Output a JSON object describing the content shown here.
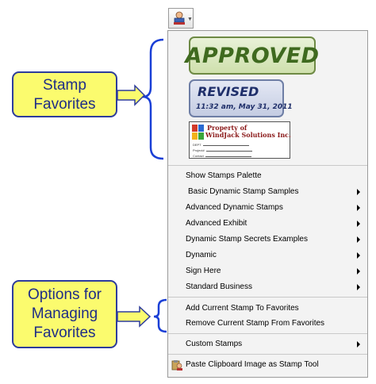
{
  "menu": {
    "items": [
      {
        "label": "Show Stamps Palette",
        "submenu": false
      },
      {
        "label": "Basic Dynamic Stamp Samples",
        "submenu": true
      },
      {
        "label": "Advanced Dynamic Stamps",
        "submenu": true
      },
      {
        "label": "Advanced Exhibit",
        "submenu": true
      },
      {
        "label": "Dynamic Stamp Secrets Examples",
        "submenu": true
      },
      {
        "label": "Dynamic",
        "submenu": true
      },
      {
        "label": "Sign Here",
        "submenu": true
      },
      {
        "label": "Standard Business",
        "submenu": true
      },
      {
        "label": "Add Current Stamp To Favorites",
        "submenu": false
      },
      {
        "label": "Remove Current Stamp From Favorites",
        "submenu": false
      },
      {
        "label": "Custom Stamps",
        "submenu": true
      },
      {
        "label": "Paste Clipboard Image as Stamp Tool",
        "submenu": false
      }
    ]
  },
  "favorites": {
    "approved": {
      "text": "APPROVED"
    },
    "revised": {
      "title": "REVISED",
      "date": "11:32 am, May 31, 2011"
    },
    "property": {
      "line1": "Property of",
      "line2": "WindJack Solutions Inc.",
      "fields": [
        "DEPT",
        "Project#",
        "Contact"
      ]
    }
  },
  "callouts": {
    "favorites": {
      "line1": "Stamp",
      "line2": "Favorites"
    },
    "managing": {
      "line1": "Options for",
      "line2": "Managing",
      "line3": "Favorites"
    }
  },
  "icons": {
    "toolbar": "stamp-tool-icon",
    "paste": "paste-clipboard-icon"
  },
  "colors": {
    "callout_fill": "#fbfb6e",
    "callout_border": "#2e3c9c",
    "bracket": "#1a3fd6",
    "approved": "#3f6a1f",
    "revised": "#1f2f6a"
  }
}
